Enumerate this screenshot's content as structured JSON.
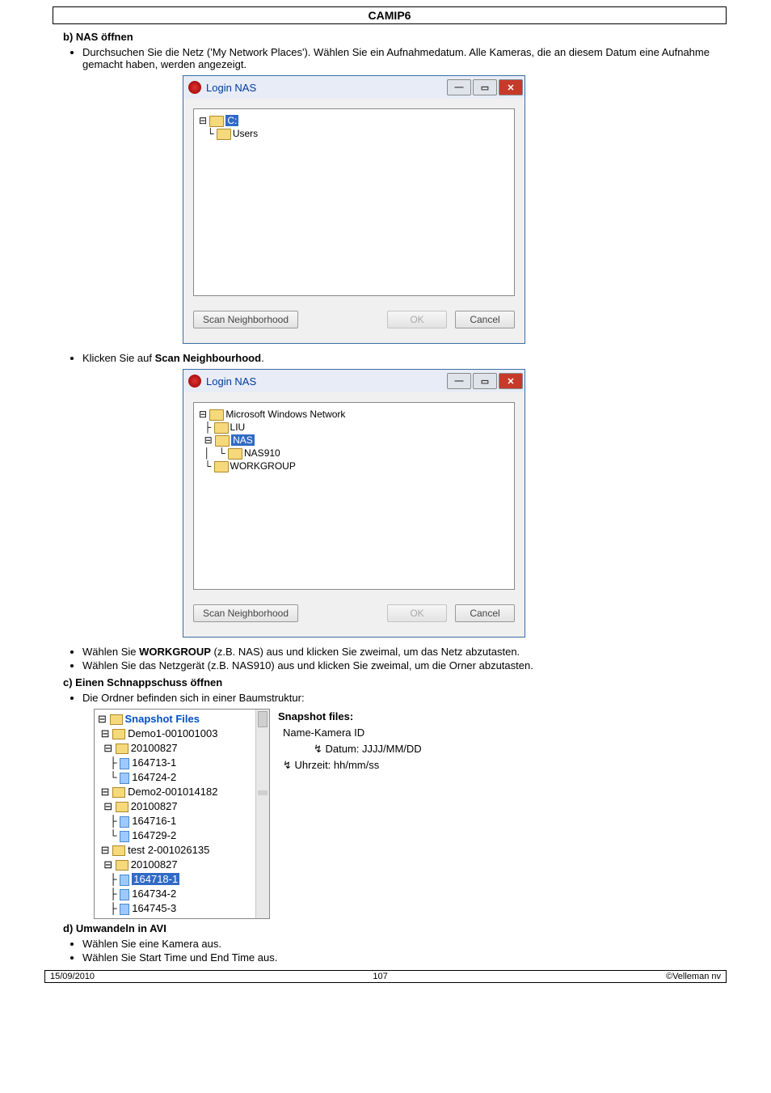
{
  "doc": {
    "title": "CAMIP6"
  },
  "sections": {
    "b": {
      "heading": "b) NAS öffnen",
      "intro": "Durchsuchen Sie die Netz ('My Network Places'). Wählen Sie ein Aufnahmedatum. Alle Kameras, die an diesem Datum eine Aufnahme gemacht haben, werden angezeigt.",
      "afterFirst": "Klicken Sie auf ",
      "afterFirstBold": "Scan Neighbourhood",
      "afterFirstTail": ".",
      "afterSecondPrefix": "Wählen Sie ",
      "afterSecondBold": "WORKGROUP",
      "afterSecondTail": " (z.B. NAS) aus und klicken Sie zweimal, um das Netz abzutasten.",
      "afterThird": "Wählen Sie das Netzgerät (z.B. NAS910) aus und klicken Sie zweimal, um die Orner abzutasten."
    },
    "c": {
      "heading": "c) Einen Schnappschuss öffnen",
      "intro": "Die Ordner befinden sich in einer Baumstruktur:"
    },
    "d": {
      "heading": "d) Umwandeln in AVI",
      "b1": "Wählen Sie eine Kamera aus.",
      "b2": "Wählen Sie Start Time und End Time aus."
    }
  },
  "dialog1": {
    "title": "Login NAS",
    "tree": {
      "root": "C:",
      "child": "Users"
    },
    "scan": "Scan Neighborhood",
    "ok": "OK",
    "cancel": "Cancel"
  },
  "dialog2": {
    "title": "Login NAS",
    "tree": {
      "root": "Microsoft Windows Network",
      "n1": "LIU",
      "n2": "NAS",
      "n3": "NAS910",
      "n4": "WORKGROUP"
    },
    "scan": "Scan Neighborhood",
    "ok": "OK",
    "cancel": "Cancel"
  },
  "snapshot": {
    "root": "Snapshot Files",
    "rows": [
      "Demo1-001001003",
      "20100827",
      "164713-1",
      "164724-2",
      "Demo2-001014182",
      "20100827",
      "164716-1",
      "164729-2",
      "test 2-001026135",
      "20100827",
      "164718-1",
      "164734-2",
      "164745-3"
    ],
    "legend": {
      "hdr": "Snapshot files:",
      "l1": "Name-Kamera ID",
      "l2": "↯ Datum: JJJJ/MM/DD",
      "l3": "↯ Uhrzeit: hh/mm/ss"
    }
  },
  "footer": {
    "left": "15/09/2010",
    "page": "107",
    "right": "©Velleman nv"
  }
}
